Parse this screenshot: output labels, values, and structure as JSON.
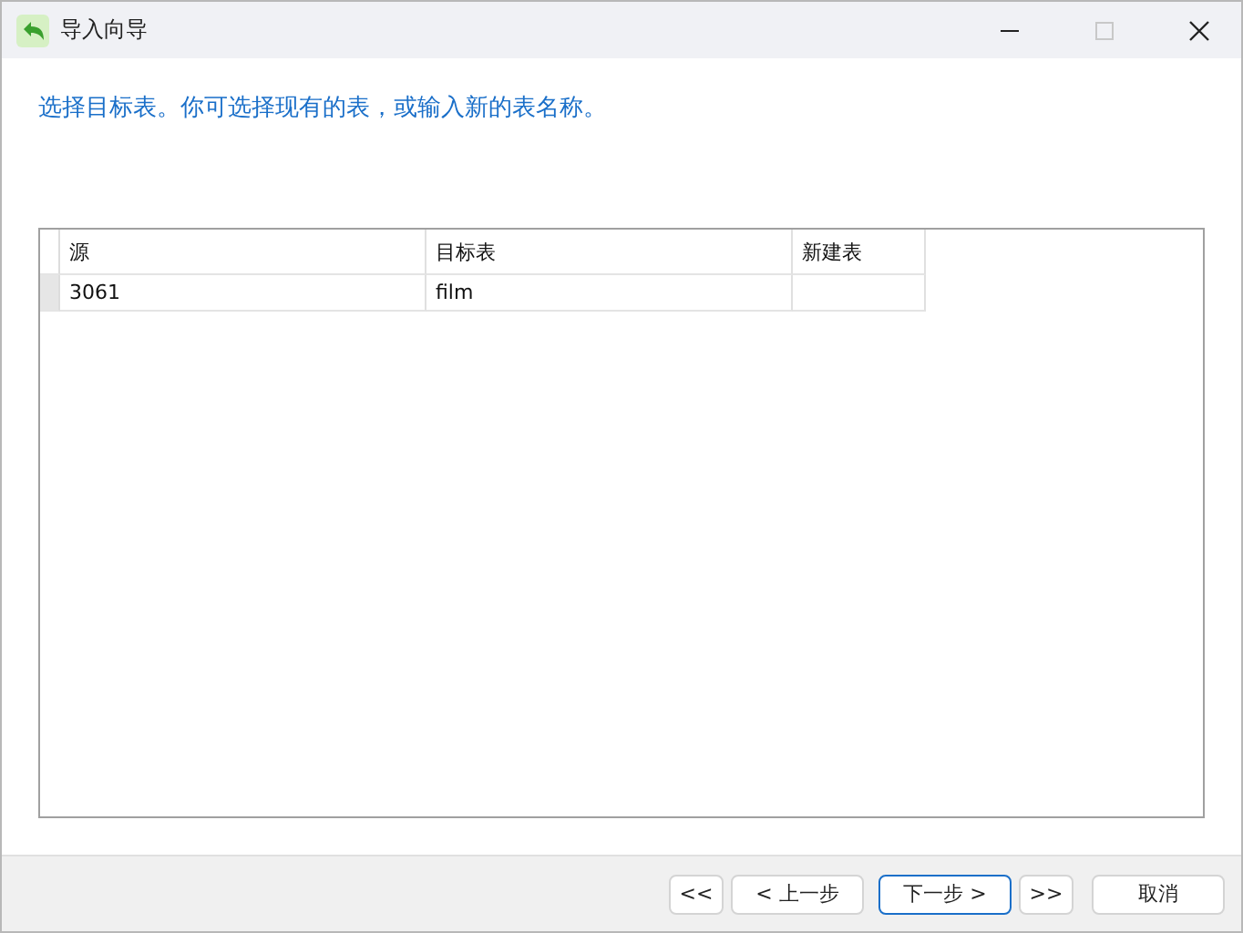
{
  "window": {
    "title": "导入向导",
    "maximize_disabled": true
  },
  "instruction": "选择目标表。你可选择现有的表，或输入新的表名称。",
  "table": {
    "columns": [
      "源",
      "目标表",
      "新建表"
    ],
    "rows": [
      {
        "cells": [
          "3061",
          "film",
          ""
        ],
        "selected": true
      }
    ]
  },
  "buttons": [
    {
      "label": "<<",
      "focused": false
    },
    {
      "label": "< 上一步",
      "focused": false
    },
    {
      "label": "下一步 >",
      "focused": true
    },
    {
      "label": ">>",
      "focused": false
    },
    {
      "label": "取消",
      "focused": false
    }
  ]
}
